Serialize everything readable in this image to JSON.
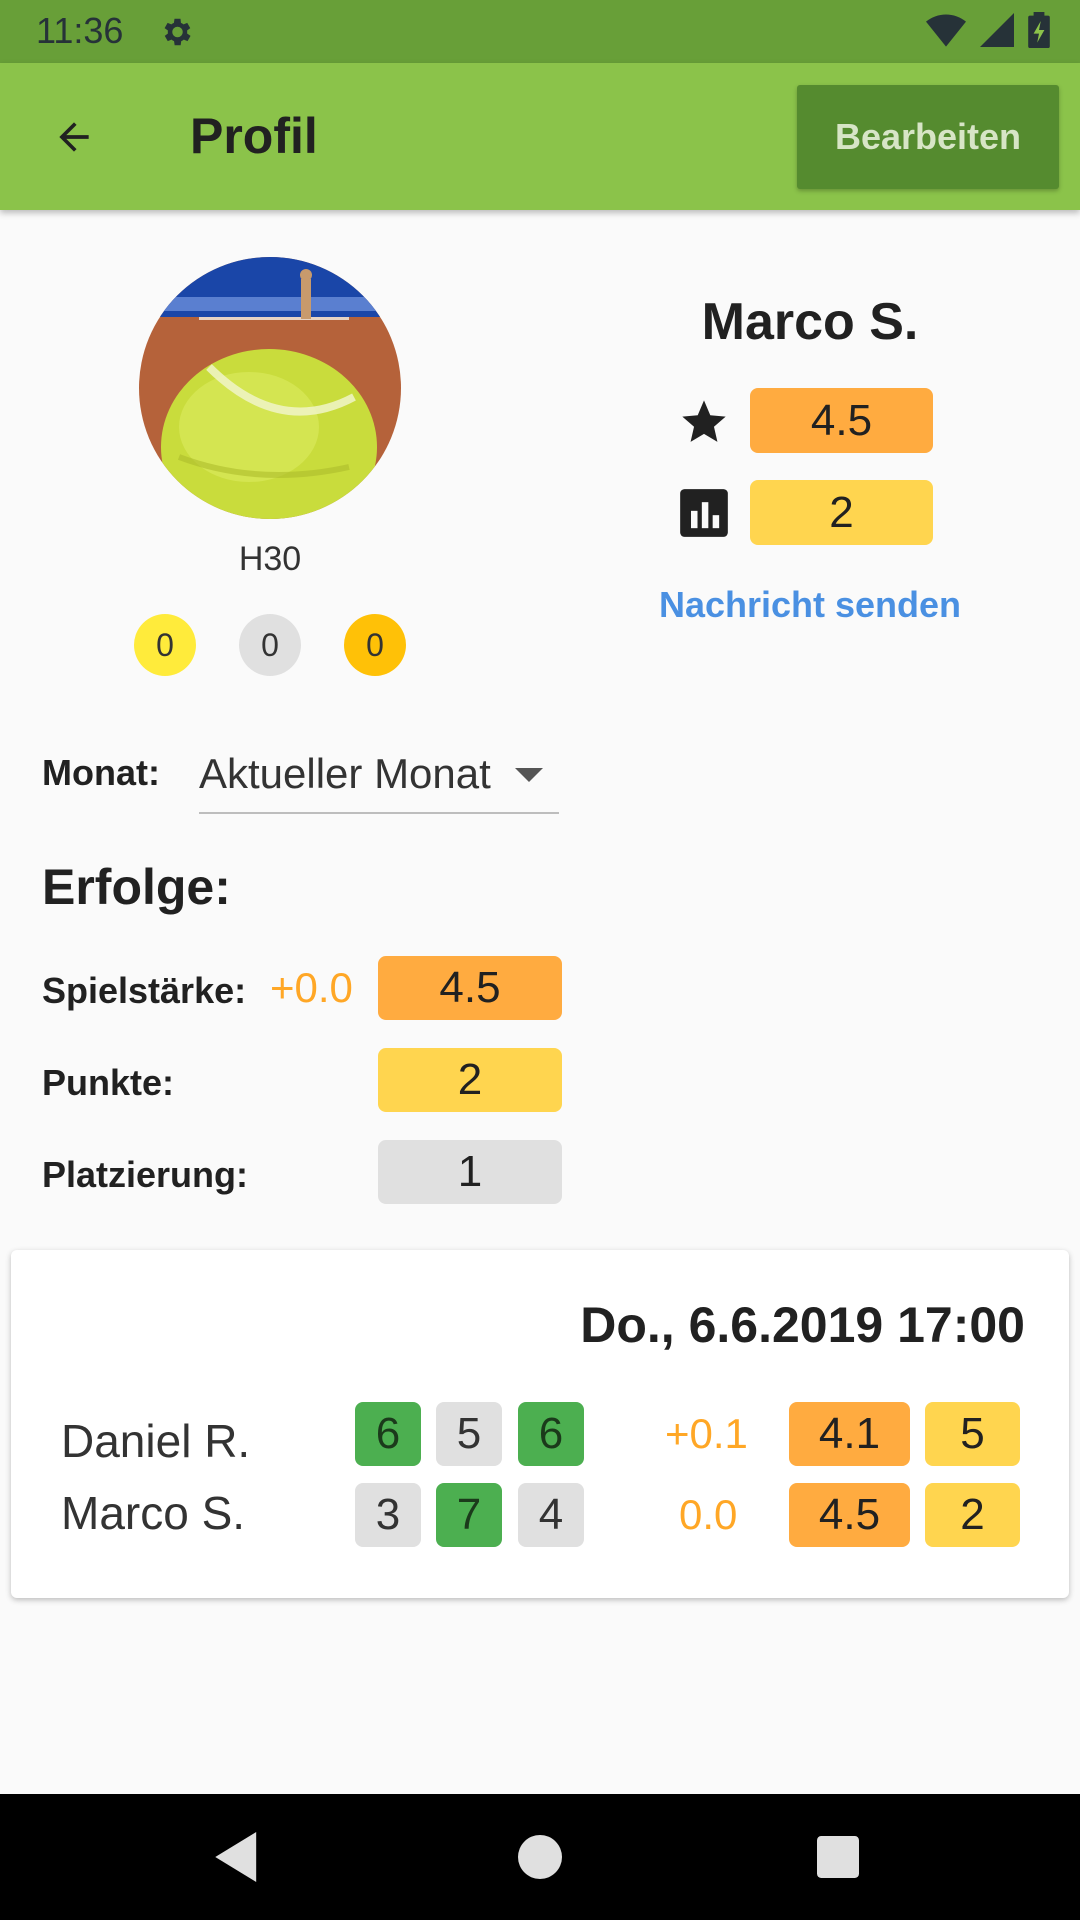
{
  "status_bar": {
    "time": "11:36"
  },
  "app_bar": {
    "title": "Profil",
    "edit_label": "Bearbeiten"
  },
  "profile": {
    "category": "H30",
    "medals": [
      "0",
      "0",
      "0"
    ],
    "name": "Marco S.",
    "rating": "4.5",
    "points": "2",
    "message_label": "Nachricht senden"
  },
  "filter": {
    "label": "Monat:",
    "value": "Aktueller Monat"
  },
  "achievements": {
    "title": "Erfolge:",
    "strength_label": "Spielstärke:",
    "strength_delta": "+0.0",
    "strength_value": "4.5",
    "points_label": "Punkte:",
    "points_value": "2",
    "rank_label": "Platzierung:",
    "rank_value": "1"
  },
  "match": {
    "date": "Do., 6.6.2019 17:00",
    "players": [
      {
        "name": "Daniel R.",
        "sets": [
          "6",
          "5",
          "6"
        ],
        "delta": "+0.1",
        "rating": "4.1",
        "points": "5"
      },
      {
        "name": "Marco S.",
        "sets": [
          "3",
          "7",
          "4"
        ],
        "delta": "0.0",
        "rating": "4.5",
        "points": "2"
      }
    ]
  },
  "colors": {
    "status_bar": "#689f38",
    "app_bar": "#8bc34a",
    "edit_button": "#558b2f",
    "rating_pill": "#ffab40",
    "points_pill": "#ffd54f",
    "set_won": "#4caf50",
    "set_lost": "#e0e0e0",
    "link": "#4a90e2",
    "delta": "#ffa726"
  }
}
